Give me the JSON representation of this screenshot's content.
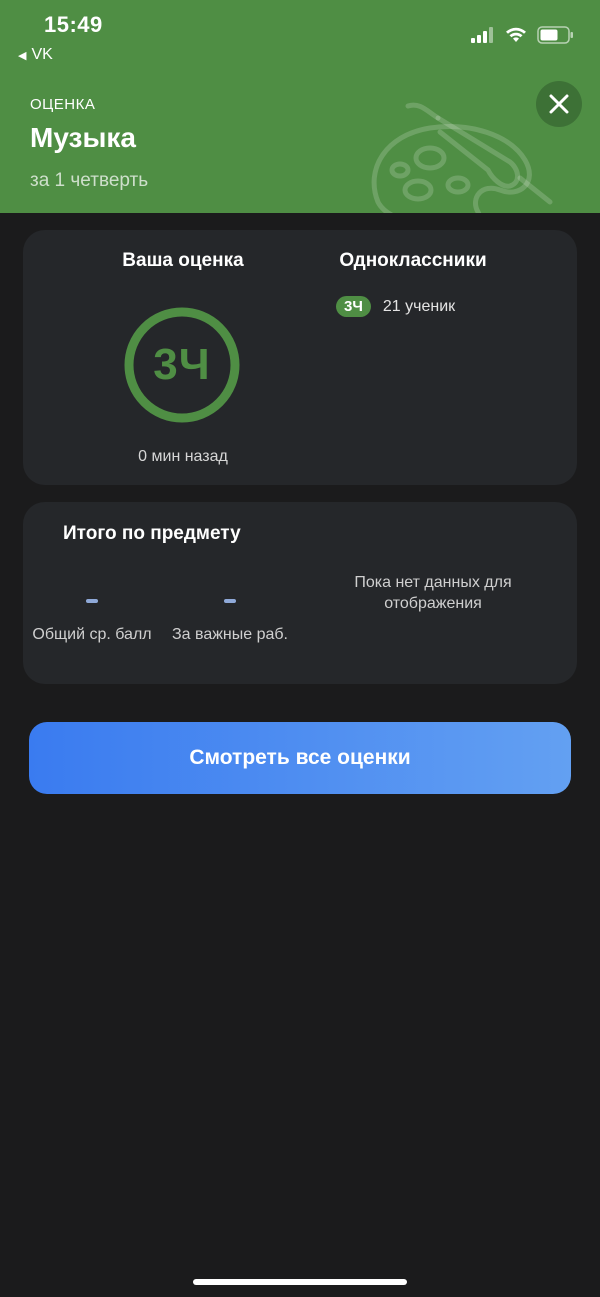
{
  "status_bar": {
    "time": "15:49"
  },
  "back": {
    "label": "VK"
  },
  "header": {
    "eyebrow": "ОЦЕНКА",
    "title": "Музыка",
    "subtitle": "за 1 четверть"
  },
  "your_grade": {
    "title": "Ваша оценка",
    "grade": "3Ч",
    "time_ago": "0 мин назад"
  },
  "classmates": {
    "title": "Одноклассники",
    "grade": "3Ч",
    "count_text": "21 ученик"
  },
  "summary": {
    "title": "Итого по предмету",
    "average_value": "-",
    "average_label": "Общий ср. балл",
    "important_value": "-",
    "important_label": "За важные раб.",
    "no_data": "Пока нет данных для отображения"
  },
  "cta": {
    "label": "Смотреть все оценки"
  },
  "colors": {
    "header_green": "#4f8e44",
    "background": "#1b1b1c",
    "card": "#25272a",
    "accent_blue": "#3a7bf0",
    "dash": "#8fa9d8"
  },
  "icons": [
    "signal-icon",
    "wifi-icon",
    "battery-icon",
    "back-triangle-icon",
    "close-icon",
    "palette-brush-icon"
  ]
}
